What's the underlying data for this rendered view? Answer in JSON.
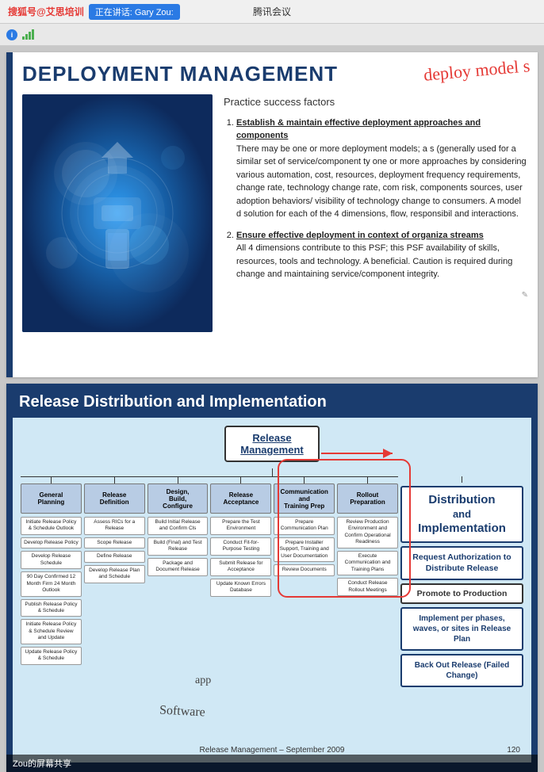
{
  "topbar": {
    "brand": "搜狐号@艾思培训",
    "meeting": "腾讯会议",
    "talking_label": "正在讲话: Gary Zou:"
  },
  "slide1": {
    "title": "DEPLOYMENT MANAGEMENT",
    "practice_title": "Practice success factors",
    "item1_heading": "Establish & maintain effective deployment approaches and components",
    "item1_text": "There may be one or more deployment models; a s (generally used for a similar set of service/component ty one or more approaches by considering various automation, cost, resources, deployment frequency requirements, change rate, technology change rate, com risk, components sources, user adoption behaviors/ visibility of technology change to consumers. A model d solution for each of the 4 dimensions, flow, responsibil and interactions.",
    "item2_heading": "Ensure effective deployment in context of organiza streams",
    "item2_text": "All 4 dimensions contribute to this PSF; this PSF availability of skills, resources, tools and technology. A beneficial. Caution is required during change and maintaining service/component integrity.",
    "handwriting": "deploy model s"
  },
  "slide2": {
    "title": "Release Distribution and Implementation",
    "rm_box_line1": "Release",
    "rm_box_line2": "Management",
    "cols": [
      {
        "header": "General Planning",
        "items": [
          "Initiate Release Policy & Schedule Outlook",
          "Develop Release Policy",
          "Develop Release Schedule",
          "90 Day Confirmed 12 Month Firm 24 Month Outlook",
          "Publish Release Policy & Schedule",
          "Initiate Release Policy & Schedule Review and Update",
          "Update Release Policy & Schedule"
        ]
      },
      {
        "header": "Release Definition",
        "items": [
          "Assess RICs for a Release",
          "Scope Release",
          "Define Release",
          "Develop Release Plan and Schedule"
        ]
      },
      {
        "header": "Design, Build, Configure",
        "items": [
          "Build Initial Release and Confirm Cls",
          "Build (Final) and Test Release",
          "Package and Document Release"
        ]
      },
      {
        "header": "Release Acceptance",
        "items": [
          "Prepare the Test Environment",
          "Conduct Fit-for-Purpose Testing",
          "Submit Release for Acceptance",
          "Update Known Errors Database"
        ]
      },
      {
        "header": "Communication and Training Prep",
        "items": [
          "Prepare Communication Plan",
          "Prepare Installer Support, Training and User Documentation",
          "Review Documents"
        ]
      },
      {
        "header": "Rollout Preparation",
        "items": [
          "Review Production Environment and Confirm Operational Readiness",
          "Execute Communication and Training Plans",
          "Conduct Release Rollout Meetings"
        ]
      }
    ],
    "right_panel": {
      "dist_line1": "Distribution",
      "dist_line2": "and",
      "dist_line3": "Implementation",
      "auth_label": "Request Authorization to Distribute Release",
      "promote_label": "Promote to Production",
      "implement_label": "Implement per phases, waves, or sites in Release Plan",
      "backout_label": "Back Out Release (Failed Change)"
    },
    "footer_text": "Release Management – September 2009",
    "page_number": "120",
    "handwriting2": "Software",
    "app_label": "app"
  },
  "share_bar": {
    "label": "Zou的屏幕共享"
  }
}
